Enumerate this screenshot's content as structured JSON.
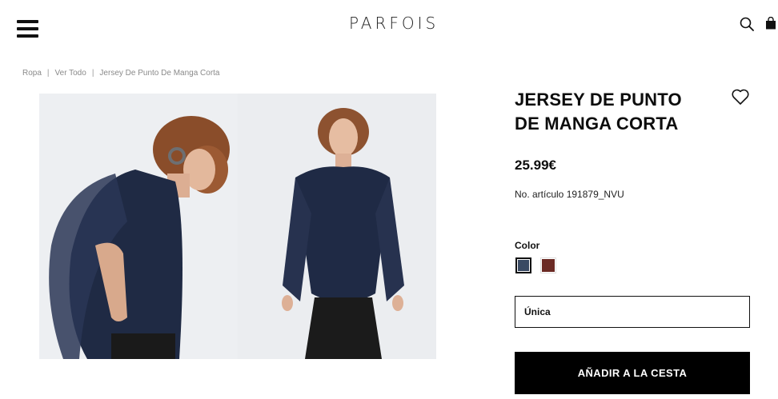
{
  "header": {
    "logo": "PARFOIS",
    "menu_icon": "hamburger-menu-icon",
    "search_icon": "search-icon",
    "bag_icon": "shopping-bag-icon"
  },
  "breadcrumb": [
    "Ropa",
    "Ver Todo",
    "Jersey De Punto De Manga Corta"
  ],
  "product": {
    "title_line1": "JERSEY DE PUNTO",
    "title_line2": "DE MANGA CORTA",
    "price": "25.99€",
    "sku": "No. artículo 191879_NVU",
    "color_label": "Color",
    "colors": [
      {
        "name": "navy",
        "hex": "#3a4a63",
        "selected": true
      },
      {
        "name": "brown",
        "hex": "#6b2a24",
        "selected": false
      }
    ],
    "size": "Única",
    "add_to_cart": "AÑADIR A LA CESTA",
    "wishlist_icon": "heart-icon"
  },
  "colors": {
    "text": "#0d0d0d",
    "button_bg": "#000000",
    "muted": "#8a8a8a"
  }
}
